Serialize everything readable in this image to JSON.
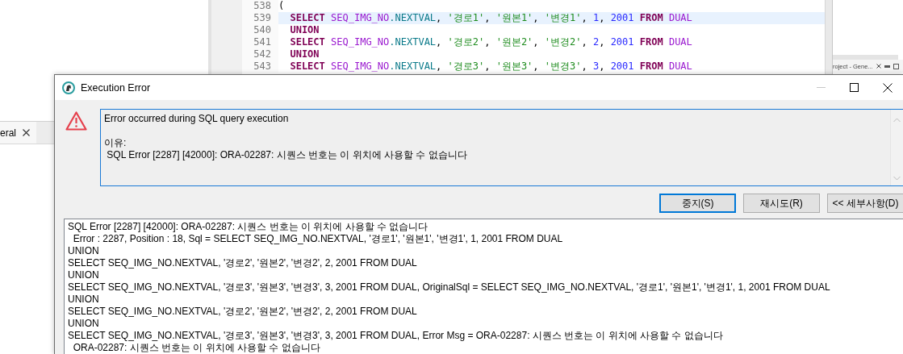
{
  "editor": {
    "lines": [
      {
        "number": "538",
        "highlighted": false,
        "tokens": [
          {
            "kind": "plain",
            "text": "("
          }
        ]
      },
      {
        "number": "539",
        "highlighted": true,
        "tokens": [
          {
            "kind": "kw",
            "text": "  SELECT "
          },
          {
            "kind": "seq",
            "text": "SEQ_IMG_NO"
          },
          {
            "kind": "field",
            "text": ".NEXTVAL"
          },
          {
            "kind": "plain",
            "text": ", "
          },
          {
            "kind": "str",
            "text": "'경로1'"
          },
          {
            "kind": "plain",
            "text": ", "
          },
          {
            "kind": "str",
            "text": "'원본1'"
          },
          {
            "kind": "plain",
            "text": ", "
          },
          {
            "kind": "str",
            "text": "'변경1'"
          },
          {
            "kind": "plain",
            "text": ", "
          },
          {
            "kind": "num",
            "text": "1"
          },
          {
            "kind": "plain",
            "text": ", "
          },
          {
            "kind": "num",
            "text": "2001"
          },
          {
            "kind": "kw",
            "text": " FROM "
          },
          {
            "kind": "seq",
            "text": "DUAL"
          }
        ]
      },
      {
        "number": "540",
        "highlighted": false,
        "tokens": [
          {
            "kind": "kw",
            "text": "  UNION"
          }
        ]
      },
      {
        "number": "541",
        "highlighted": false,
        "tokens": [
          {
            "kind": "kw",
            "text": "  SELECT "
          },
          {
            "kind": "seq",
            "text": "SEQ_IMG_NO"
          },
          {
            "kind": "field",
            "text": ".NEXTVAL"
          },
          {
            "kind": "plain",
            "text": ", "
          },
          {
            "kind": "str",
            "text": "'경로2'"
          },
          {
            "kind": "plain",
            "text": ", "
          },
          {
            "kind": "str",
            "text": "'원본2'"
          },
          {
            "kind": "plain",
            "text": ", "
          },
          {
            "kind": "str",
            "text": "'변경2'"
          },
          {
            "kind": "plain",
            "text": ", "
          },
          {
            "kind": "num",
            "text": "2"
          },
          {
            "kind": "plain",
            "text": ", "
          },
          {
            "kind": "num",
            "text": "2001"
          },
          {
            "kind": "kw",
            "text": " FROM "
          },
          {
            "kind": "seq",
            "text": "DUAL"
          }
        ]
      },
      {
        "number": "542",
        "highlighted": false,
        "tokens": [
          {
            "kind": "kw",
            "text": "  UNION"
          }
        ]
      },
      {
        "number": "543",
        "highlighted": false,
        "tokens": [
          {
            "kind": "kw",
            "text": "  SELECT "
          },
          {
            "kind": "seq",
            "text": "SEQ_IMG_NO"
          },
          {
            "kind": "field",
            "text": ".NEXTVAL"
          },
          {
            "kind": "plain",
            "text": ", "
          },
          {
            "kind": "str",
            "text": "'경로3'"
          },
          {
            "kind": "plain",
            "text": ", "
          },
          {
            "kind": "str",
            "text": "'원본3'"
          },
          {
            "kind": "plain",
            "text": ", "
          },
          {
            "kind": "str",
            "text": "'변경3'"
          },
          {
            "kind": "plain",
            "text": ", "
          },
          {
            "kind": "num",
            "text": "3"
          },
          {
            "kind": "plain",
            "text": ", "
          },
          {
            "kind": "num",
            "text": "2001"
          },
          {
            "kind": "kw",
            "text": " FROM "
          },
          {
            "kind": "seq",
            "text": "DUAL"
          }
        ]
      }
    ]
  },
  "left_panel": {
    "tab": {
      "label": "eral",
      "selected": true
    }
  },
  "right_panel": {
    "tab": {
      "label": "roject - Gene...",
      "selected": false
    }
  },
  "dialog": {
    "title": "Execution Error",
    "controls": [
      {
        "kind": "minimize",
        "disabled": true
      },
      {
        "kind": "maximize",
        "disabled": false
      },
      {
        "kind": "close",
        "disabled": false
      }
    ],
    "message": {
      "title": "Error occurred during SQL query execution",
      "reason_label": "이유:",
      "reason": " SQL Error [2287] [42000]: ORA-02287: 시퀀스 번호는 이 위치에 사용할 수 없습니다"
    },
    "buttons": [
      {
        "label": "중지(S)",
        "focused": true
      },
      {
        "label": "재시도(R)",
        "focused": false
      },
      {
        "label": "<< 세부사항(D)",
        "focused": false
      }
    ],
    "details": [
      "SQL Error [2287] [42000]: ORA-02287: 시퀀스 번호는 이 위치에 사용할 수 없습니다",
      "  Error : 2287, Position : 18, Sql = SELECT SEQ_IMG_NO.NEXTVAL, '경로1', '원본1', '변경1', 1, 2001 FROM DUAL",
      "UNION",
      "SELECT SEQ_IMG_NO.NEXTVAL, '경로2', '원본2', '변경2', 2, 2001 FROM DUAL",
      "UNION",
      "SELECT SEQ_IMG_NO.NEXTVAL, '경로3', '원본3', '변경3', 3, 2001 FROM DUAL, OriginalSql = SELECT SEQ_IMG_NO.NEXTVAL, '경로1', '원본1', '변경1', 1, 2001 FROM DUAL",
      "UNION",
      "SELECT SEQ_IMG_NO.NEXTVAL, '경로2', '원본2', '변경2', 2, 2001 FROM DUAL",
      "UNION",
      "SELECT SEQ_IMG_NO.NEXTVAL, '경로3', '원본3', '변경3', 3, 2001 FROM DUAL, Error Msg = ORA-02287: 시퀀스 번호는 이 위치에 사용할 수 없습니다",
      "  ORA-02287: 시퀀스 번호는 이 위치에 사용할 수 없습니다"
    ]
  }
}
